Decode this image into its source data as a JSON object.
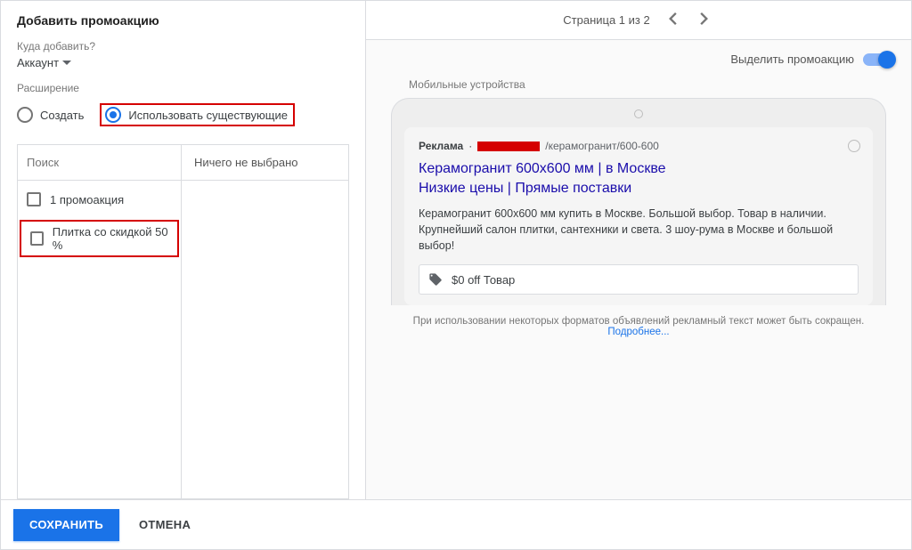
{
  "left": {
    "title": "Добавить промоакцию",
    "whereLabel": "Куда добавить?",
    "accountValue": "Аккаунт",
    "extLabel": "Расширение",
    "radioCreate": "Создать",
    "radioExisting": "Использовать существующие",
    "searchPlaceholder": "Поиск",
    "noneSelected": "Ничего не выбрано",
    "items": [
      {
        "label": "1 промоакция"
      },
      {
        "label": "Плитка со скидкой 50 %"
      }
    ]
  },
  "right": {
    "pager": "Страница 1 из 2",
    "toggleLabel": "Выделить промоакцию",
    "deviceLabel": "Мобильные устройства",
    "ad": {
      "badge": "Реклама",
      "dot": "·",
      "urlTail": "/керамогранит/600-600",
      "headline1": "Керамогранит 600х600 мм | в Москве",
      "headline2": "Низкие цены | Прямые поставки",
      "desc": "Керамогранит 600х600 мм купить в Москве. Большой выбор. Товар в наличии. Крупнейший салон плитки, сантехники и света. 3 шоу-рума в Москве и большой выбор!",
      "promoText": "$0 off Товар"
    },
    "captionText": "При использовании некоторых форматов объявлений рекламный текст может быть сокращен. ",
    "captionLink": "Подробнее..."
  },
  "footer": {
    "save": "СОХРАНИТЬ",
    "cancel": "ОТМЕНА"
  }
}
